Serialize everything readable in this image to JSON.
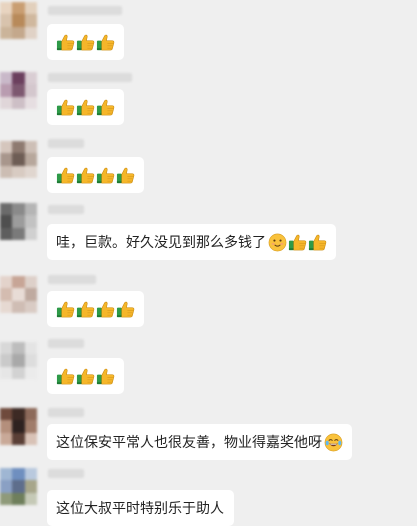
{
  "messages": [
    {
      "text": "",
      "emojis": [
        "thumbs-up",
        "thumbs-up",
        "thumbs-up"
      ]
    },
    {
      "text": "",
      "emojis": [
        "thumbs-up",
        "thumbs-up",
        "thumbs-up"
      ]
    },
    {
      "text": "",
      "emojis": [
        "thumbs-up",
        "thumbs-up",
        "thumbs-up",
        "thumbs-up"
      ]
    },
    {
      "text": "哇，巨款。好久没见到那么多钱了",
      "emojis": [
        "smile-face",
        "thumbs-up",
        "thumbs-up"
      ]
    },
    {
      "text": "",
      "emojis": [
        "thumbs-up",
        "thumbs-up",
        "thumbs-up",
        "thumbs-up"
      ]
    },
    {
      "text": "",
      "emojis": [
        "thumbs-up",
        "thumbs-up",
        "thumbs-up"
      ]
    },
    {
      "text": "这位保安平常人也很友善，物业得嘉奖他呀",
      "emojis": [
        "laugh-tears-face"
      ]
    },
    {
      "text": "这位大叔平时特别乐于助人",
      "emojis": []
    }
  ],
  "colors": {
    "background": "#efefef",
    "bubble": "#ffffff",
    "thumb_fill": "#f5b62a",
    "sleeve": "#2e9a48"
  }
}
